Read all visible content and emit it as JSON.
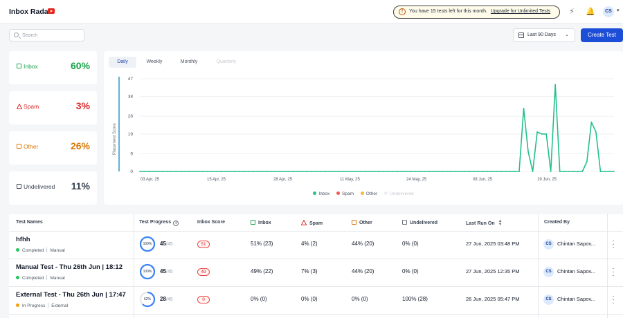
{
  "header": {
    "app_title": "Inbox Radar",
    "notice_text": "You have 15 tests left for this month.",
    "notice_link": "Upgrade for Unlimited Tests",
    "user_initials": "CS",
    "icons": [
      "youtube-icon",
      "info-icon",
      "bolt-icon",
      "bell-icon"
    ]
  },
  "toolbar": {
    "search_placeholder": "Search",
    "date_range": "Last 90 Days",
    "create_label": "Create Test"
  },
  "stats": [
    {
      "label": "Inbox",
      "value": "60%",
      "color": "#16a34a",
      "icon": "inbox-icon"
    },
    {
      "label": "Spam",
      "value": "3%",
      "color": "#dc2626",
      "icon": "warning-icon"
    },
    {
      "label": "Other",
      "value": "26%",
      "color": "#d97706",
      "icon": "mail-icon"
    },
    {
      "label": "Undelivered",
      "value": "11%",
      "color": "#374151",
      "icon": "mail-x-icon"
    }
  ],
  "chart_tabs": [
    {
      "label": "Daily",
      "state": "active"
    },
    {
      "label": "Weekly",
      "state": "normal"
    },
    {
      "label": "Monthly",
      "state": "normal"
    },
    {
      "label": "Quarterly",
      "state": "disabled"
    }
  ],
  "chart_data": {
    "type": "line",
    "ylabel": "Placement Score",
    "ylim": [
      0,
      47
    ],
    "yticks": [
      0,
      9,
      19,
      28,
      38,
      47
    ],
    "x_tick_labels": [
      "03 Apr, 25",
      "15 Apr, 25",
      "28 Apr, 25",
      "11 May, 25",
      "24 May, 25",
      "08 Jun, 25",
      "19 Jun, 25"
    ],
    "grid": true,
    "legend": [
      "Inbox",
      "Spam",
      "Other",
      "Undelivered"
    ],
    "legend_colors": [
      "#22c08a",
      "#ef5b4c",
      "#f5b83b",
      "#e5e7eb"
    ],
    "series": [
      {
        "name": "Inbox",
        "color": "#22c08a",
        "values": [
          0,
          0,
          0,
          0,
          0,
          0,
          0,
          0,
          0,
          0,
          0,
          0,
          0,
          0,
          0,
          0,
          0,
          0,
          0,
          0,
          0,
          0,
          0,
          0,
          0,
          0,
          0,
          0,
          0,
          0,
          0,
          0,
          0,
          0,
          0,
          0,
          0,
          0,
          0,
          0,
          0,
          0,
          0,
          0,
          0,
          0,
          0,
          0,
          0,
          0,
          0,
          0,
          0,
          0,
          0,
          0,
          0,
          0,
          0,
          0,
          0,
          0,
          0,
          0,
          0,
          0,
          0,
          0,
          0,
          0,
          0,
          0,
          0,
          0,
          0,
          0,
          0,
          0,
          0,
          0,
          0,
          0,
          0,
          0,
          0,
          32,
          10,
          0,
          20,
          19,
          19,
          0,
          44,
          0,
          0,
          0,
          0,
          0,
          0,
          5,
          25,
          20,
          0,
          0,
          0,
          0
        ]
      }
    ]
  },
  "table": {
    "headers": {
      "name": "Test Names",
      "progress": "Test Progress",
      "score": "Inbox Score",
      "inbox": "Inbox",
      "spam": "Spam",
      "other": "Other",
      "undelivered": "Undelivered",
      "last_run": "Last Run On",
      "created_by": "Created By"
    },
    "rows": [
      {
        "name": "hfhh",
        "status": "Completed",
        "status_color": "#22c55e",
        "type": "Manual",
        "progress_pct": "100%",
        "progress_fraction": 1.0,
        "progress_done": "45",
        "progress_total": "/45",
        "score": "51",
        "inbox": "51% (23)",
        "spam": "4% (2)",
        "other": "44% (20)",
        "undelivered": "0% (0)",
        "last_run": "27 Jun, 2025 03:48 PM",
        "initials": "CS",
        "owner": "Chintan Sapov..."
      },
      {
        "name": "Manual Test - Thu 26th Jun | 18:12",
        "status": "Completed",
        "status_color": "#22c55e",
        "type": "Manual",
        "progress_pct": "100%",
        "progress_fraction": 1.0,
        "progress_done": "45",
        "progress_total": "/45",
        "score": "49",
        "inbox": "49% (22)",
        "spam": "7% (3)",
        "other": "44% (20)",
        "undelivered": "0% (0)",
        "last_run": "27 Jun, 2025 12:35 PM",
        "initials": "CS",
        "owner": "Chintan Sapov..."
      },
      {
        "name": "External Test - Thu 26th Jun | 17:47",
        "status": "In Progress",
        "status_color": "#f59e0b",
        "type": "External",
        "progress_pct": "62%",
        "progress_fraction": 0.62,
        "progress_done": "28",
        "progress_total": "/45",
        "score": "0",
        "inbox": "0% (0)",
        "spam": "0% (0)",
        "other": "0% (0)",
        "undelivered": "100% (28)",
        "last_run": "26 Jun, 2025 05:47 PM",
        "initials": "CS",
        "owner": "Chintan Sapov..."
      }
    ]
  }
}
